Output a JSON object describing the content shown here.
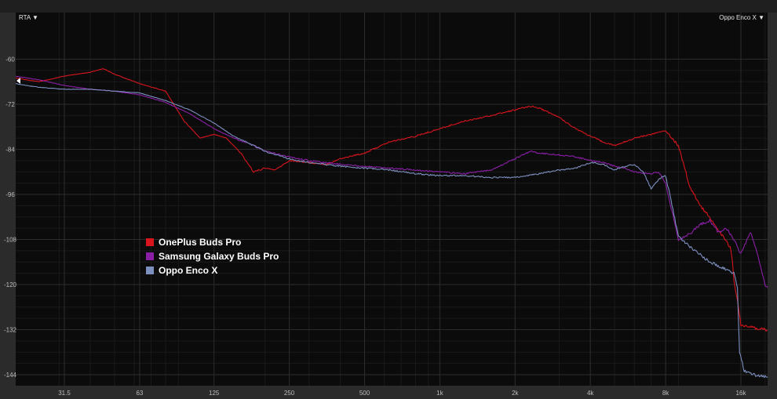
{
  "controls": {
    "mode_dropdown": "RTA ▼",
    "source_dropdown": "Oppo Enco X ▼"
  },
  "chart_data": {
    "type": "line",
    "title": "",
    "xlabel": "",
    "ylabel": "",
    "x_scale": "log",
    "xlim": [
      20,
      22000
    ],
    "ylim": [
      -150,
      -68
    ],
    "x_ticks": [
      31.5,
      63,
      125,
      250,
      500,
      1000,
      2000,
      4000,
      8000,
      16000
    ],
    "x_tick_labels": [
      "31.5",
      "63",
      "125",
      "250",
      "500",
      "1k",
      "2k",
      "4k",
      "8k",
      "16k"
    ],
    "y_ticks": [
      -60,
      -72,
      -84,
      -96,
      -108,
      -120,
      -132,
      -144
    ],
    "y_tick_labels": [
      "-60",
      "-72",
      "-84",
      "-96",
      "-108",
      "-120",
      "-132",
      "-144"
    ],
    "grid": true,
    "legend_position": "left-middle",
    "background": "#0b0b0b",
    "series": [
      {
        "name": "OnePlus Buds Pro",
        "color": "#d8141c",
        "x": [
          20,
          25,
          31.5,
          40,
          45,
          50,
          63,
          80,
          95,
          110,
          125,
          140,
          160,
          180,
          200,
          220,
          250,
          300,
          350,
          400,
          500,
          630,
          800,
          1000,
          1250,
          1600,
          2000,
          2300,
          2500,
          3000,
          3500,
          4000,
          4500,
          5000,
          5500,
          6000,
          7000,
          8000,
          9000,
          10000,
          11000,
          12000,
          12800,
          13500,
          14500,
          14800,
          15000,
          15500,
          16000,
          18000,
          20000,
          22000
        ],
        "y": [
          -65,
          -66,
          -64.5,
          -63.5,
          -62.5,
          -64,
          -66.5,
          -68.5,
          -76.5,
          -81,
          -80,
          -81,
          -85,
          -90,
          -89,
          -89.5,
          -87,
          -87.5,
          -88,
          -86.5,
          -85,
          -82,
          -80.5,
          -78.5,
          -76.5,
          -75,
          -73.5,
          -72.5,
          -73,
          -75.5,
          -78.5,
          -80.5,
          -82,
          -83,
          -82,
          -81,
          -80,
          -79,
          -83,
          -94,
          -99,
          -102,
          -105,
          -107,
          -110,
          -114,
          -119,
          -124,
          -131,
          -131.5,
          -132,
          -132.5
        ]
      },
      {
        "name": "Samsung Galaxy Buds Pro",
        "color": "#8a1fa6",
        "x": [
          20,
          25,
          31.5,
          40,
          50,
          63,
          80,
          100,
          125,
          150,
          180,
          200,
          250,
          300,
          400,
          500,
          630,
          800,
          1000,
          1250,
          1600,
          2000,
          2300,
          2500,
          3000,
          3500,
          4000,
          4500,
          5000,
          5500,
          6000,
          7000,
          7500,
          8000,
          9000,
          10000,
          11000,
          12000,
          13000,
          14000,
          15000,
          16000,
          17500,
          19000,
          20000,
          22000
        ],
        "y": [
          -64.5,
          -65.5,
          -67,
          -68,
          -68.5,
          -69.5,
          -71.5,
          -74.5,
          -78.5,
          -81,
          -83,
          -84.5,
          -86,
          -87,
          -88,
          -88.5,
          -89,
          -89.5,
          -90,
          -90.5,
          -89.5,
          -86.5,
          -84.5,
          -85,
          -85.5,
          -86,
          -87,
          -87.5,
          -88.5,
          -89,
          -90,
          -90.5,
          -90,
          -93,
          -108,
          -106.5,
          -104,
          -103,
          -106,
          -105,
          -108,
          -112,
          -106,
          -114,
          -120,
          -125
        ]
      },
      {
        "name": "Oppo Enco X",
        "color": "#7c8fbf",
        "x": [
          20,
          25,
          31.5,
          40,
          50,
          63,
          80,
          100,
          125,
          150,
          180,
          200,
          250,
          300,
          400,
          500,
          630,
          800,
          1000,
          1250,
          1600,
          2000,
          2500,
          3000,
          3500,
          4000,
          4500,
          5000,
          5500,
          6000,
          6500,
          7000,
          7500,
          8000,
          9000,
          10000,
          11000,
          12000,
          13000,
          14000,
          15000,
          15500,
          15800,
          16500,
          18000,
          20000,
          22000
        ],
        "y": [
          -66.5,
          -67.5,
          -68,
          -68,
          -68.5,
          -69,
          -71,
          -73.5,
          -77,
          -80.5,
          -83,
          -84.5,
          -86.5,
          -87.5,
          -88.5,
          -89,
          -89.5,
          -90.5,
          -91,
          -91,
          -91.5,
          -91.5,
          -90.5,
          -89.5,
          -89,
          -87.5,
          -88,
          -89.5,
          -88.5,
          -88,
          -90,
          -94.5,
          -92,
          -91,
          -107,
          -110,
          -112,
          -114,
          -115,
          -116,
          -117,
          -121,
          -138,
          -143,
          -144,
          -144.5,
          -145
        ]
      }
    ]
  }
}
